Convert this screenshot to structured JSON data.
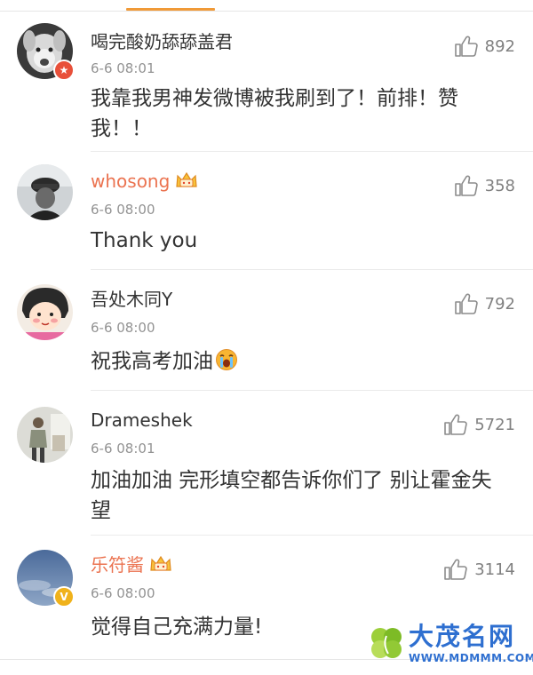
{
  "comments": [
    {
      "username": "喝完酸奶舔舔盖君",
      "time": "6-6 08:01",
      "likes": "892",
      "text": "我靠我男神发微博被我刷到了！前排！赞我！！",
      "vip": false,
      "avatar_badge": "star"
    },
    {
      "username": "whosong",
      "time": "6-6 08:00",
      "likes": "358",
      "text": "Thank you",
      "vip": true
    },
    {
      "username": "吾处木同Y",
      "time": "6-6 08:00",
      "likes": "792",
      "text": "祝我高考加油",
      "vip": false,
      "emoji": "crying-emoji"
    },
    {
      "username": "Drameshek",
      "time": "6-6 08:01",
      "likes": "5721",
      "text": "加油加油 完形填空都告诉你们了 别让霍金失望",
      "vip": false
    },
    {
      "username": "乐符酱",
      "time": "6-6 08:00",
      "likes": "3114",
      "text": "觉得自己充满力量!",
      "vip": true,
      "avatar_badge": "verified-v"
    }
  ],
  "watermark": {
    "title": "大茂名网",
    "url": "WWW.MDMMM.COM"
  },
  "colors": {
    "vip_name": "#eb7350",
    "accent_tab": "#f09a38",
    "meta": "#939393"
  }
}
